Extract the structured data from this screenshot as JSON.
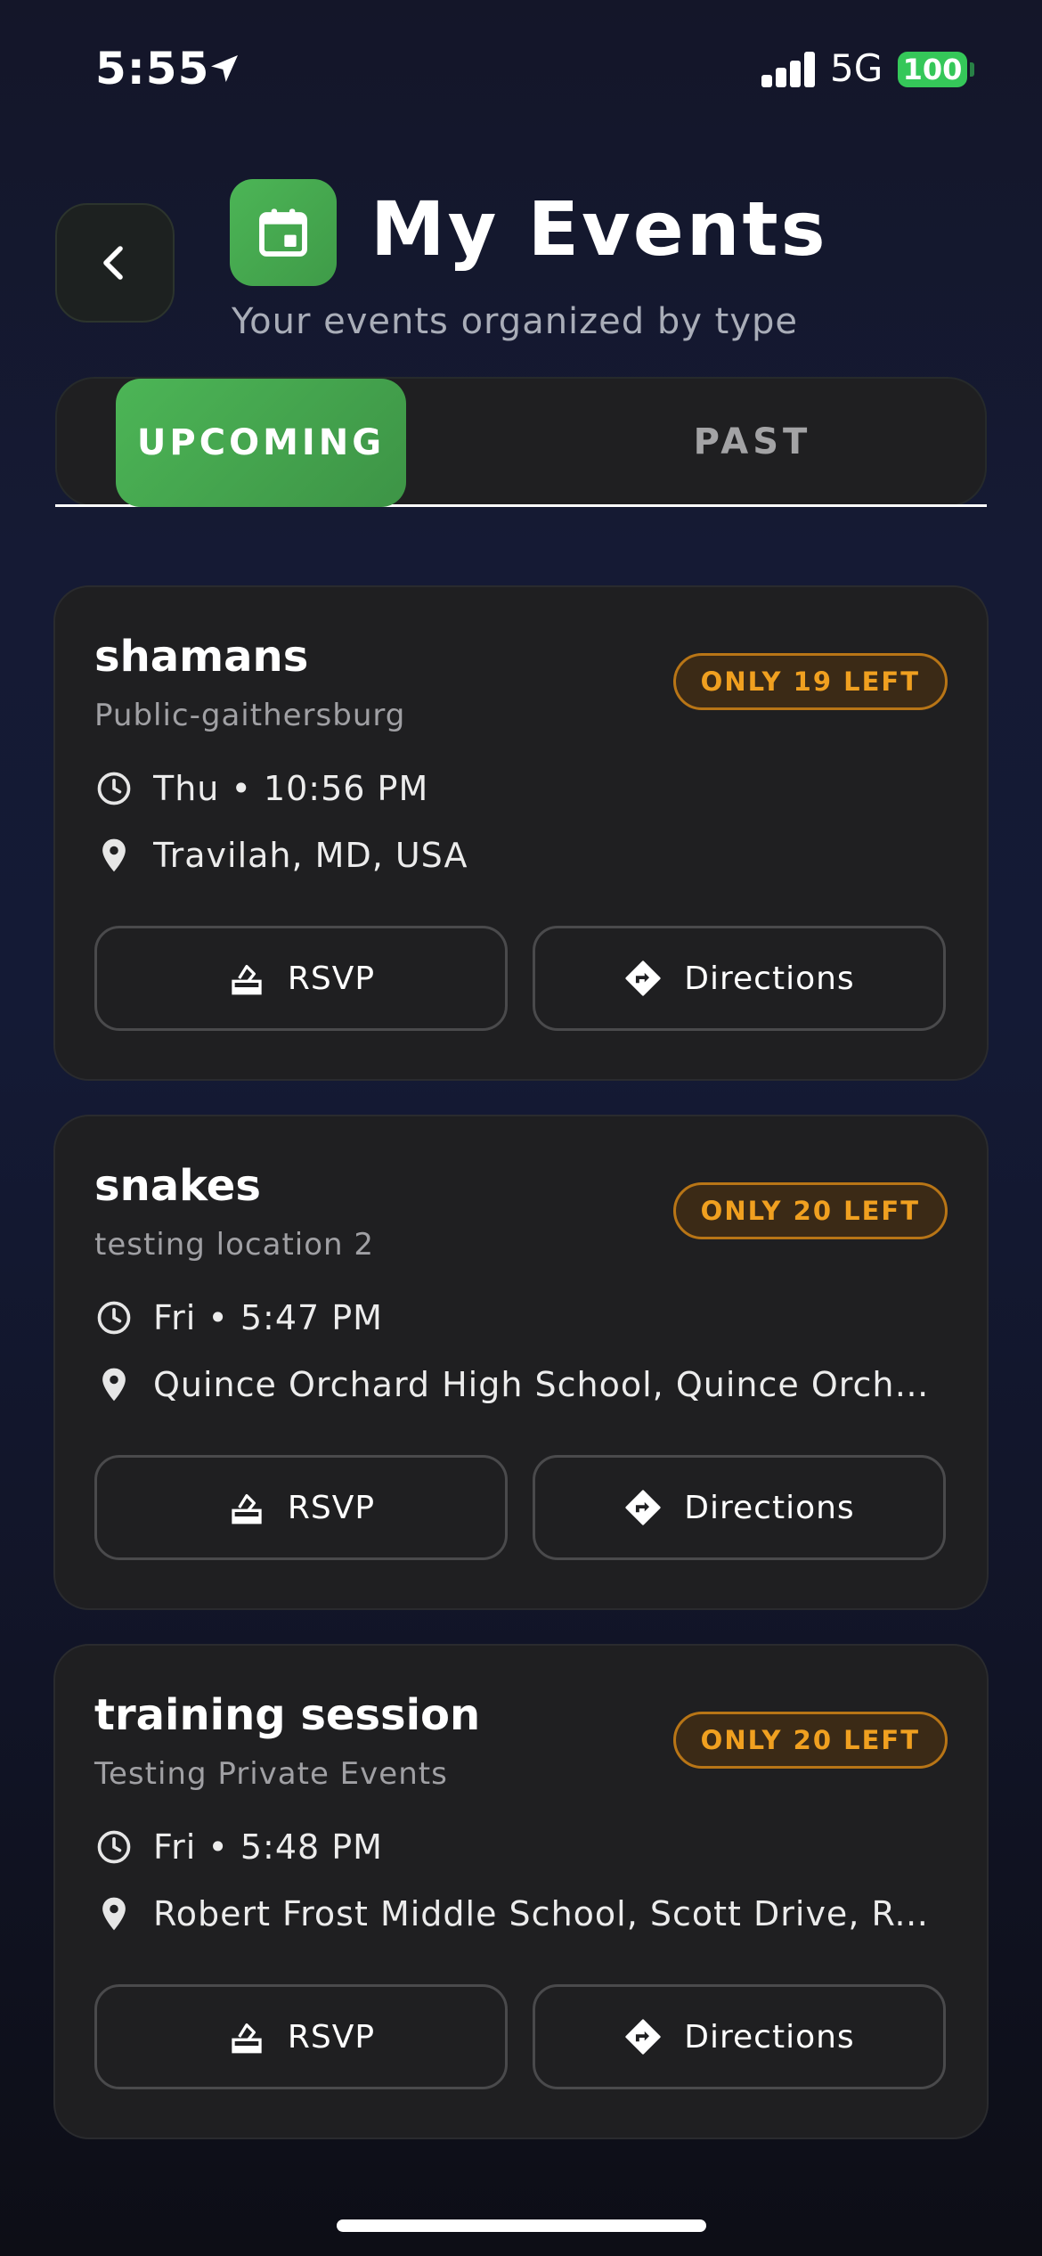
{
  "status_bar": {
    "time": "5:55",
    "network": "5G",
    "battery": "100"
  },
  "header": {
    "title": "My Events",
    "subtitle": "Your events organized by type"
  },
  "tabs": [
    {
      "label": "UPCOMING",
      "active": true
    },
    {
      "label": "PAST",
      "active": false
    }
  ],
  "events": [
    {
      "title": "shamans",
      "subtitle": "Public-gaithersburg",
      "badge": "ONLY 19 LEFT",
      "time": "Thu • 10:56 PM",
      "location": "Travilah, MD, USA",
      "rsvp_label": "RSVP",
      "directions_label": "Directions"
    },
    {
      "title": "snakes",
      "subtitle": "testing location 2",
      "badge": "ONLY 20 LEFT",
      "time": "Fri • 5:47 PM",
      "location": "Quince Orchard High School, Quince Orchar...",
      "rsvp_label": "RSVP",
      "directions_label": "Directions"
    },
    {
      "title": "training session",
      "subtitle": "Testing Private Events",
      "badge": "ONLY 20 LEFT",
      "time": "Fri • 5:48 PM",
      "location": "Robert Frost Middle School, Scott Drive, Roc...",
      "rsvp_label": "RSVP",
      "directions_label": "Directions"
    }
  ],
  "colors": {
    "accent_green": "#4cb556",
    "badge_orange": "#f0a020",
    "battery_green": "#35c759"
  },
  "icons": {
    "back": "chevron-left-icon",
    "header": "calendar-icon",
    "time": "clock-icon",
    "location": "map-pin-icon",
    "rsvp": "ballot-box-icon",
    "directions": "directions-sign-icon"
  }
}
